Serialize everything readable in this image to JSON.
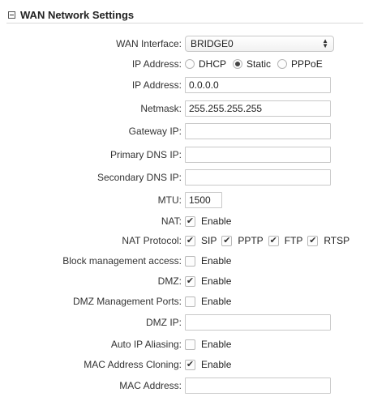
{
  "section": {
    "title": "WAN Network Settings"
  },
  "wan_interface": {
    "label": "WAN Interface:",
    "value": "BRIDGE0"
  },
  "ip_mode": {
    "label": "IP Address:",
    "options": [
      "DHCP",
      "Static",
      "PPPoE"
    ],
    "selected": "Static"
  },
  "ip_address": {
    "label": "IP Address:",
    "value": "0.0.0.0"
  },
  "netmask": {
    "label": "Netmask:",
    "value": "255.255.255.255"
  },
  "gateway_ip": {
    "label": "Gateway IP:",
    "value": ""
  },
  "primary_dns": {
    "label": "Primary DNS IP:",
    "value": ""
  },
  "secondary_dns": {
    "label": "Secondary DNS IP:",
    "value": ""
  },
  "mtu": {
    "label": "MTU:",
    "value": "1500"
  },
  "nat": {
    "label": "NAT:",
    "option": "Enable",
    "checked": true
  },
  "nat_protocol": {
    "label": "NAT Protocol:",
    "items": [
      {
        "name": "SIP",
        "checked": true
      },
      {
        "name": "PPTP",
        "checked": true
      },
      {
        "name": "FTP",
        "checked": true
      },
      {
        "name": "RTSP",
        "checked": true
      }
    ]
  },
  "block_mgmt": {
    "label": "Block management access:",
    "option": "Enable",
    "checked": false
  },
  "dmz": {
    "label": "DMZ:",
    "option": "Enable",
    "checked": true
  },
  "dmz_mgmt_ports": {
    "label": "DMZ Management Ports:",
    "option": "Enable",
    "checked": false
  },
  "dmz_ip": {
    "label": "DMZ IP:",
    "value": ""
  },
  "auto_ip_aliasing": {
    "label": "Auto IP Aliasing:",
    "option": "Enable",
    "checked": false
  },
  "mac_cloning": {
    "label": "MAC Address Cloning:",
    "option": "Enable",
    "checked": true
  },
  "mac_address": {
    "label": "MAC Address:",
    "value": ""
  }
}
